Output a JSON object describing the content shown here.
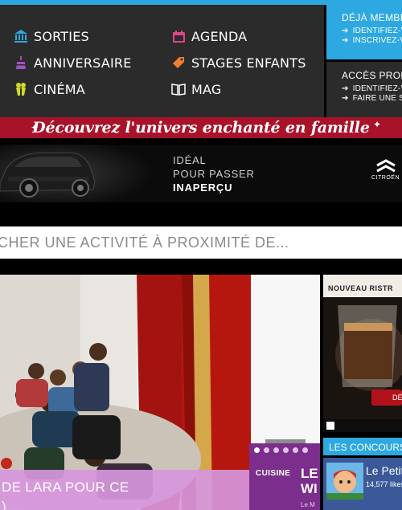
{
  "nav": {
    "items": [
      {
        "label": "SORTIES",
        "icon": "museum-icon",
        "color": "#2ea8e0"
      },
      {
        "label": "AGENDA",
        "icon": "calendar-icon",
        "color": "#e0448a"
      },
      {
        "label": "ANNIVERSAIRE",
        "icon": "birthday-cake-icon",
        "color": "#a050c0"
      },
      {
        "label": "STAGES ENFANTS",
        "icon": "tag-icon",
        "color": "#f08030"
      },
      {
        "label": "CINÉMA",
        "icon": "popcorn-icon",
        "color": "#d4d82a"
      },
      {
        "label": "MAG",
        "icon": "book-icon",
        "color": "#ffffff"
      }
    ]
  },
  "member_box": {
    "title": "DÉJÀ MEMBRE",
    "links": [
      "IDENTIFIEZ-V",
      "INSCRIVEZ-V"
    ]
  },
  "pro_box": {
    "title": "ACCÈS PROF",
    "links": [
      "IDENTIFIEZ-V",
      "FAIRE UNE S"
    ]
  },
  "banner": {
    "text": "Découvrez l'univers enchanté en famille"
  },
  "ad": {
    "line1": "IDÉAL",
    "line2": "POUR PASSER",
    "line3": "INAPERÇU",
    "brand": "CITROËN"
  },
  "search": {
    "placeholder": "CHER UNE ACTIVITÉ À PROXIMITÉ DE..."
  },
  "hero": {
    "caption_line1": " DE LARA POUR CE",
    "caption_line2": ")",
    "category": "CUISINE",
    "side_title_1": "LE",
    "side_title_2": "WI",
    "side_sub": "Le M"
  },
  "right": {
    "ad_headline": "NOUVEAU RISTR",
    "ad_button": "DÉ",
    "contest_label": "LES CONCOURS",
    "fb_name": "Le Petit",
    "fb_likes": "14,577 likes"
  },
  "colors": {
    "accent_blue": "#2ea8e0",
    "banner_red": "#a8132a",
    "nav_bg": "#2b2b2b",
    "purple": "#7b2e8c"
  }
}
